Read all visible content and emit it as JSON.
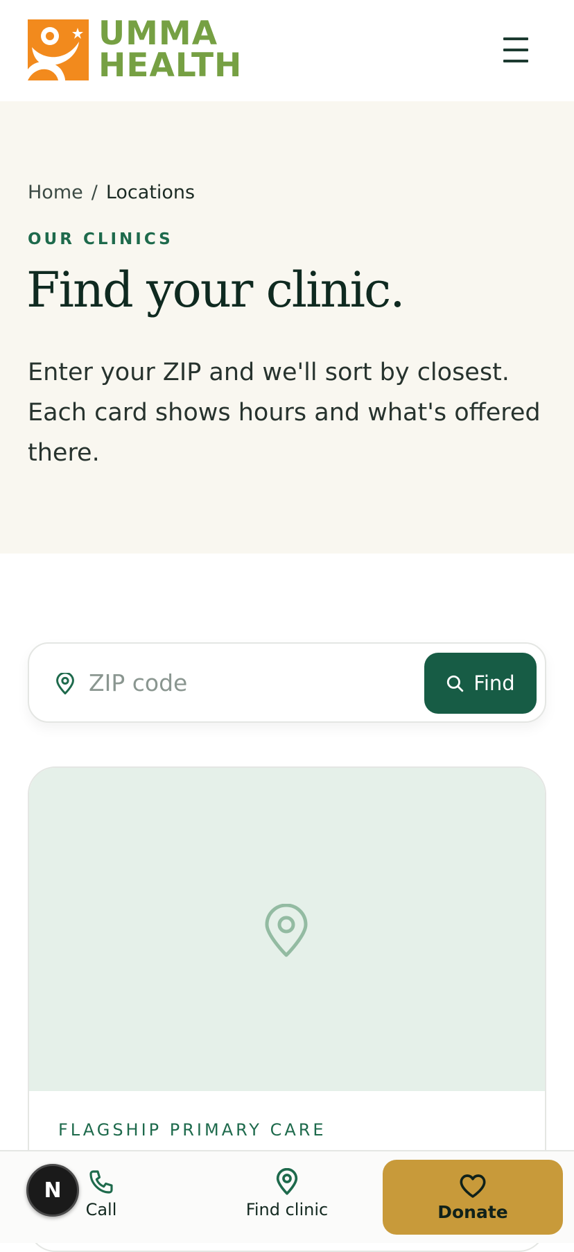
{
  "brand": {
    "line1": "UMMA",
    "line2": "HEALTH",
    "colors": {
      "logo_orange": "#f28a1d",
      "logo_green": "#76a043"
    }
  },
  "header": {
    "menu_icon": "hamburger-menu-icon"
  },
  "breadcrumb": {
    "home": "Home",
    "separator": "/",
    "current": "Locations"
  },
  "hero": {
    "eyebrow": "OUR CLINICS",
    "title": "Find your clinic.",
    "description": "Enter your ZIP and we'll sort by closest. Each card shows hours and what's offered there."
  },
  "search": {
    "placeholder": "ZIP code",
    "value": "",
    "button_label": "Find",
    "pin_icon": "map-pin-icon",
    "button_icon": "search-icon"
  },
  "clinic_card": {
    "eyebrow": "FLAGSHIP PRIMARY CARE",
    "map_icon": "map-pin-icon"
  },
  "bottom_nav": {
    "call_label": "Call",
    "find_label": "Find clinic",
    "donate_label": "Donate",
    "call_icon": "phone-icon",
    "find_icon": "map-pin-icon",
    "donate_icon": "heart-icon"
  },
  "floating_badge": {
    "letter": "N"
  },
  "colors": {
    "primary_green": "#175c45",
    "accent_green": "#1e6a4c",
    "hero_bg": "#f9f7f0",
    "map_bg": "#e5f0e9",
    "donate_gold": "#c89a3a"
  }
}
